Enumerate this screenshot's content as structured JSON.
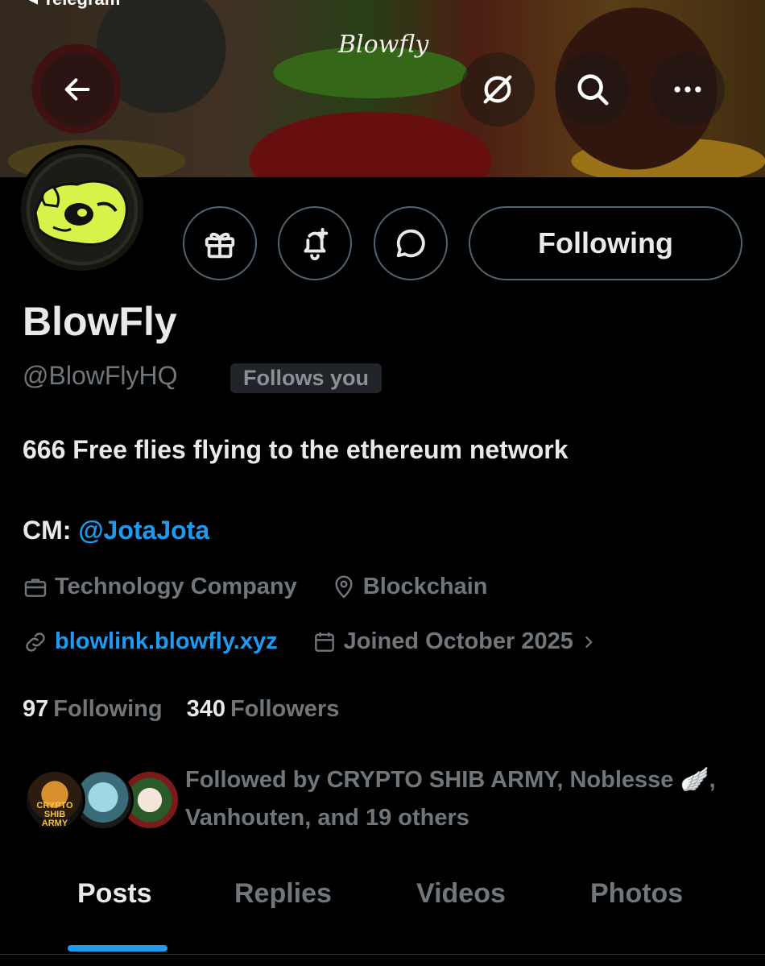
{
  "status": {
    "back_app_label": "◂ Telegram"
  },
  "banner": {
    "logo_text": "Blowfly"
  },
  "header": {
    "back_icon": "arrow-left-icon",
    "grok_icon": "grok-icon",
    "search_icon": "search-icon",
    "more_icon": "more-horizontal-icon"
  },
  "actions": {
    "gift_icon": "gift-icon",
    "notify_icon": "bell-plus-icon",
    "message_icon": "chat-bubble-icon",
    "following_label": "Following"
  },
  "profile": {
    "name": "BlowFly",
    "handle": "@BlowFlyHQ",
    "follows_you": "Follows you",
    "bio_line1": "666 Free flies flying to the ethereum network",
    "bio_cm_prefix": "CM: ",
    "bio_cm_mention": "@JotaJota",
    "category": "Technology Company",
    "location": "Blockchain",
    "website": "blowlink.blowfly.xyz",
    "joined": "Joined October 2025",
    "following_count": "97",
    "following_label": "Following",
    "followers_count": "340",
    "followers_label": "Followers",
    "followed_by_line1": "Followed by CRYPTO SHIB ARMY, Noblesse 🪽,",
    "followed_by_line2": "Vanhouten, and 19 others",
    "followed_avatar_label": "CRYPTO SHIB ARMY"
  },
  "tabs": [
    {
      "label": "Posts",
      "active": true
    },
    {
      "label": "Replies",
      "active": false
    },
    {
      "label": "Videos",
      "active": false
    },
    {
      "label": "Photos",
      "active": false
    }
  ],
  "colors": {
    "accent": "#1d9bf0",
    "background": "#000000",
    "text_primary": "#e7e9ea",
    "text_secondary": "#71767b",
    "border": "#536471"
  }
}
